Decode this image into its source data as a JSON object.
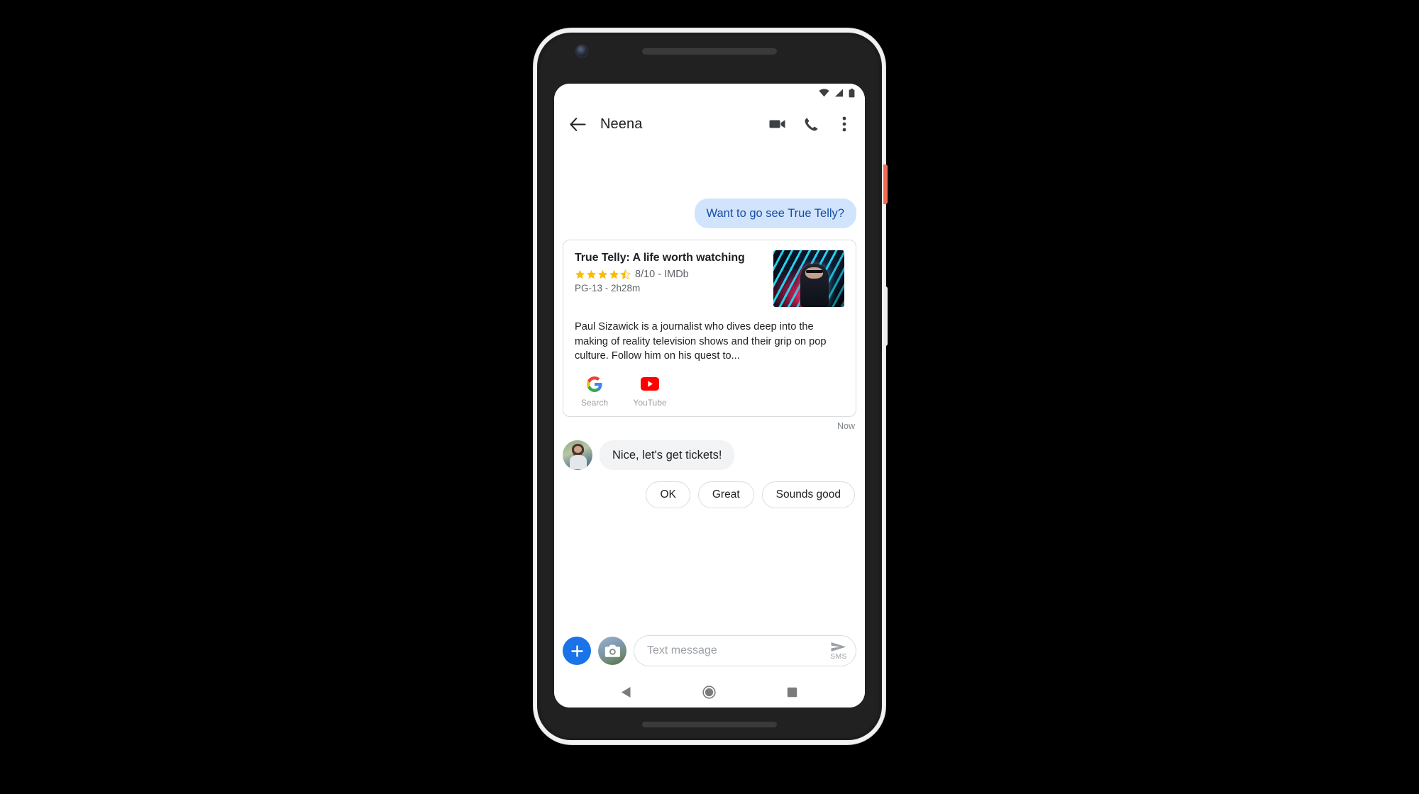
{
  "device": {
    "name": "pixel-phone",
    "frame_color": "#f2f2f2",
    "body_color": "#1d1d1d",
    "power_button_color": "#ef6b52"
  },
  "statusbar": {
    "wifi_icon": "wifi-icon",
    "signal_icon": "cell-signal-icon",
    "battery_icon": "battery-icon"
  },
  "appbar": {
    "back_icon": "back-arrow-icon",
    "title": "Neena",
    "video_call_icon": "video-camera-icon",
    "phone_call_icon": "phone-icon",
    "overflow_icon": "more-vert-icon"
  },
  "conversation": {
    "outgoing_message": "Want to go see True Telly?",
    "timestamp": "Now",
    "incoming_message": "Nice, let's get tickets!",
    "avatar_name": "contact-avatar"
  },
  "card": {
    "title": "True Telly: A life worth watching",
    "rating_value": 4.5,
    "rating_text": "8/10 - IMDb",
    "meta": "PG-13 - 2h28m",
    "description": "Paul Sizawick is a journalist who dives deep into the making of reality television shows and their grip on pop culture. Follow him on his quest to...",
    "poster_alt": "movie-poster",
    "actions": [
      {
        "label": "Search",
        "icon": "google-g-icon"
      },
      {
        "label": "YouTube",
        "icon": "youtube-icon"
      }
    ]
  },
  "suggestions": [
    {
      "label": "OK"
    },
    {
      "label": "Great"
    },
    {
      "label": "Sounds good"
    }
  ],
  "composer": {
    "plus_icon": "plus-icon",
    "camera_icon": "camera-icon",
    "placeholder": "Text message",
    "input_value": "",
    "send_icon": "send-icon",
    "send_label": "SMS"
  },
  "navbar": {
    "back_icon": "nav-back-triangle-icon",
    "home_icon": "nav-home-circle-icon",
    "recents_icon": "nav-recents-square-icon"
  },
  "colors": {
    "accent_blue": "#1a73e8",
    "outgoing_bubble": "#d2e3fc",
    "outgoing_text": "#174ea6",
    "incoming_bubble": "#f1f3f4",
    "star_gold": "#fbbc04",
    "youtube_red": "#ff0000",
    "muted_text": "#5f6368"
  }
}
